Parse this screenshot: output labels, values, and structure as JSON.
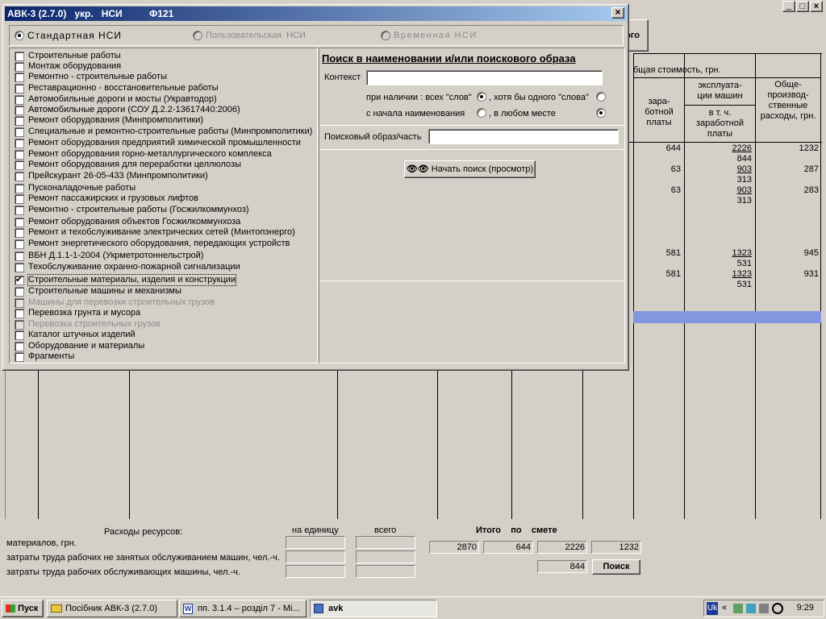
{
  "dialog": {
    "title": "АВК-3 (2.7.0)   укр.   НСИ          Ф121",
    "close": "×",
    "nsi_modes": [
      {
        "label": "Стандартная НСИ",
        "selected": true,
        "enabled": true
      },
      {
        "label": "Пользовательская  НСИ",
        "selected": false,
        "enabled": false
      },
      {
        "label": "Временная НСИ",
        "selected": false,
        "enabled": false
      }
    ],
    "catalog": [
      {
        "label": "Строительные работы",
        "checked": false,
        "enabled": true
      },
      {
        "label": "Монтаж оборудования",
        "checked": false,
        "enabled": true
      },
      {
        "label": "Ремонтно - строительные работы",
        "checked": false,
        "enabled": true
      },
      {
        "label": "Реставрационно - восстановительные работы",
        "checked": false,
        "enabled": true
      },
      {
        "label": "Автомобильные дороги и мосты (Укравтодор)",
        "checked": false,
        "enabled": true
      },
      {
        "label": "Автомобильные дороги (СОУ Д.2.2-13617440:2006)",
        "checked": false,
        "enabled": true
      },
      {
        "label": "Ремонт оборудования (Минпромполитики)",
        "checked": false,
        "enabled": true
      },
      {
        "label": "Специальные и ремонтно-строительные работы (Минпромполитики)",
        "checked": false,
        "enabled": true
      },
      {
        "label": "Ремонт оборудования предприятий химической промышленности",
        "checked": false,
        "enabled": true
      },
      {
        "label": "Ремонт оборудования  горно-металлургического комплекса",
        "checked": false,
        "enabled": true
      },
      {
        "label": "Ремонт оборудования для переработки целлюлозы",
        "checked": false,
        "enabled": true
      },
      {
        "label": "Прейскурант 26-05-433 (Минпромполитики)",
        "checked": false,
        "enabled": true
      },
      {
        "label": "Пусконаладочные работы",
        "checked": false,
        "enabled": true
      },
      {
        "label": "Ремонт пассажирских и грузовых лифтов",
        "checked": false,
        "enabled": true
      },
      {
        "label": "Ремонтно - строительные работы (Госжилкоммунхоз)",
        "checked": false,
        "enabled": true
      },
      {
        "label": "Ремонт оборудования объектов Госжилкоммунхоза",
        "checked": false,
        "enabled": true
      },
      {
        "label": "Ремонт и техобслуживание электрических сетей (Минтопэнерго)",
        "checked": false,
        "enabled": true
      },
      {
        "label": "Ремонт энергетического оборудования, передающих устройств",
        "checked": false,
        "enabled": true
      },
      {
        "label": "ВБН Д.1.1-1-2004 (Укрметротоннельстрой)",
        "checked": false,
        "enabled": true
      },
      {
        "label": "Техобслуживание охранно-пожарной сигнализации",
        "checked": false,
        "enabled": true
      },
      {
        "label": "Строительные материалы, изделия и конструкции",
        "checked": true,
        "enabled": true
      },
      {
        "label": "Строительные машины и механизмы",
        "checked": false,
        "enabled": true
      },
      {
        "label": "Машины для перевозки строительных грузов",
        "checked": false,
        "enabled": false
      },
      {
        "label": "Перевозка грунта и мусора",
        "checked": false,
        "enabled": true
      },
      {
        "label": "Перевозка строительных грузов",
        "checked": false,
        "enabled": false
      },
      {
        "label": "Каталог штучных изделий",
        "checked": false,
        "enabled": true
      },
      {
        "label": "Оборудование и материалы",
        "checked": false,
        "enabled": true
      },
      {
        "label": "Фрагменты",
        "checked": false,
        "enabled": true
      }
    ],
    "search": {
      "heading": "Поиск в наименовании и/или поискового образа",
      "context_label": "Контекст",
      "context_value": "",
      "presence_label": "при наличии :  всех \"слов\"",
      "any_word_label": ", хотя бы одного \"слова\"",
      "from_start_label": "с начала наименования",
      "anywhere_label": ", в любом месте",
      "pattern_label": "Поисковый образ/часть",
      "pattern_value": "",
      "start_button": "Начать поиск (просмотр)"
    }
  },
  "background": {
    "partial_button": "ого",
    "header_total": "бщая стоимость, грн.",
    "col_salary": "зара-\nботной\nплаты",
    "col_machines": "эксплуата-\nции машин",
    "col_machines_sub": "в т. ч.\nзаработной\nплаты",
    "col_overhead": "Обще-\nпроизвод-\nственные\nрасходы, грн.",
    "rows": [
      {
        "salary": "644",
        "machines": "2226",
        "machines_sub": "844",
        "overhead": "1232"
      },
      {
        "salary": "63",
        "machines": "903",
        "machines_sub": "313",
        "overhead": "287"
      },
      {
        "salary": "63",
        "machines": "903",
        "machines_sub": "313",
        "overhead": "283"
      },
      {
        "salary": "581",
        "machines": "1323",
        "machines_sub": "531",
        "overhead": "945"
      },
      {
        "salary": "581",
        "machines": "1323",
        "machines_sub": "531",
        "overhead": "931"
      }
    ]
  },
  "resources": {
    "title": "Расходы ресурсов:",
    "per_unit": "на единицу",
    "total": "всего",
    "rows": [
      "материалов, грн.",
      "затраты труда рабочих не занятых обслуживанием машин, чел.-ч.",
      "затраты труда рабочих обслуживающих машины, чел.-ч."
    ],
    "totals_label": "Итого    по    смете",
    "totals": [
      "2870",
      "644",
      "2226",
      "1232"
    ],
    "machine_salary_total": "844",
    "search_button": "Поиск"
  },
  "window_controls": [
    "_",
    "□",
    "×"
  ],
  "taskbar": {
    "start": "Пуск",
    "tasks": [
      "Посібник АВК-3 (2.7.0)",
      "пп. 3.1.4 – розділ 7 - Mi...",
      "avk"
    ],
    "lang": "Uk",
    "clock": "9:29"
  },
  "colors": {
    "title_start": "#0a246a",
    "title_end": "#a6caf0",
    "highlight_row": "#8496e0"
  }
}
